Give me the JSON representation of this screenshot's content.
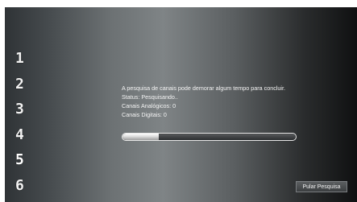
{
  "steps": [
    "1",
    "2",
    "3",
    "4",
    "5",
    "6"
  ],
  "active_step": "5",
  "message": "A pesquisa de canais pode demorar algum tempo para concluir.",
  "status": "Status: Pesquisando..",
  "analog_channels": "Canais Analógicos: 0",
  "digital_channels": "Canais Digitais: 0",
  "progress_fraction": 0.21,
  "skip_button_label": "Pular Pesquisa",
  "colors": {
    "text": "#f4f4f4",
    "progress_fill": "#ffffff",
    "background_dark": "#0f1011"
  }
}
